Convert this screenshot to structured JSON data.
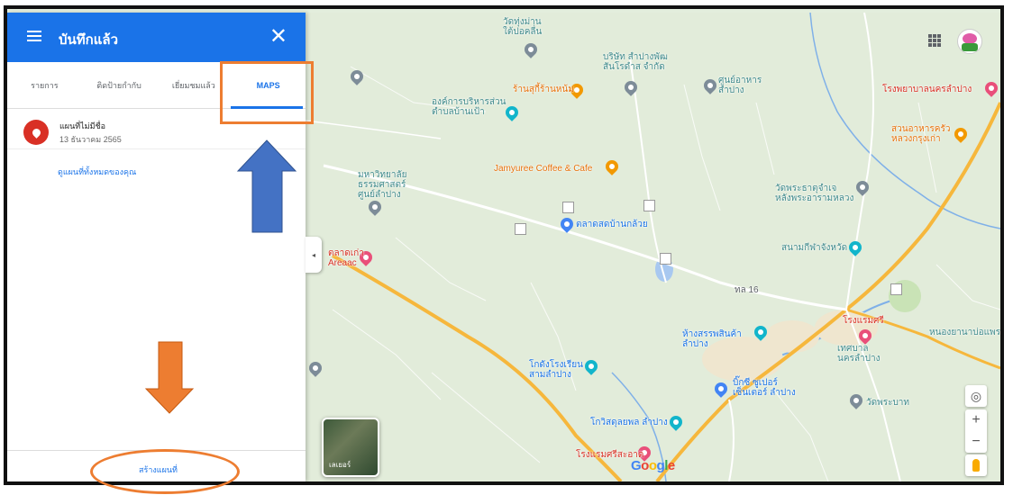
{
  "panel": {
    "title": "บันทึกแล้ว",
    "tabs": [
      "รายการ",
      "ติดป้ายกำกับ",
      "เยี่ยมชมแล้ว",
      "MAPS"
    ],
    "active_tab": "MAPS",
    "map_item": {
      "title": "แผนที่ไม่มีชื่อ",
      "date": "13 ธันวาคม 2565"
    },
    "all_maps_link": "ดูแผนที่ทั้งหมดของคุณ",
    "create_map": "สร้างแผนที่"
  },
  "map": {
    "layer_label": "เลเยอร์",
    "road_label": "ทล 16",
    "pois": [
      {
        "label": "วัดทุ่งม่าน\nใต้ปอคลื่น"
      },
      {
        "label": "บริษัท สำปางพัฒ\nสันโรดำส จำกัด"
      },
      {
        "label": "ศูนย์อาหาร\nสำปาง"
      },
      {
        "label": "ร้านสุกี้ร้านหน้ม"
      },
      {
        "label": "องค์การบริหารส่วน\nตำบลบ้านเป้า"
      },
      {
        "label": "Jamyuree Coffee & Cafe"
      },
      {
        "label": "มหาวิทยาลัย\nธรรมศาสตร์\nศูนย์ลำปาง"
      },
      {
        "label": "ตลาดสดบ้านกล้วย"
      },
      {
        "label": "วัดพระธาตุจำเจ\nหลังพระอารามหลวง"
      },
      {
        "label": "สนามกีฬาจังหวัด"
      },
      {
        "label": "โรงพยาบาลนครลำปาง"
      },
      {
        "label": "สวนอาหารครัว\nหลวงกรุงเก่า"
      },
      {
        "label": "ตลาดเก่า\nAreaac"
      },
      {
        "label": "ห้างสรรพสินค้า\nลำปาง"
      },
      {
        "label": "โรงแรมศรี"
      },
      {
        "label": "เทศบาล\nนครลำปาง"
      },
      {
        "label": "โกดังโรงเรียน\nสามลำปาง"
      },
      {
        "label": "บิ๊กซี ซูเปอร์\nเซ็นเตอร์ ลำปาง"
      },
      {
        "label": "วัดพระบาท"
      },
      {
        "label": "โกวิสดุลยพล ลำปาง"
      },
      {
        "label": "โรงแรมศรีสะอาด"
      },
      {
        "label": "หนองยานาบ่อแพร"
      }
    ]
  },
  "attribution": {
    "google": [
      "G",
      "o",
      "o",
      "g",
      "l",
      "e"
    ]
  },
  "colors": {
    "accent": "#1a73e8",
    "annotation": "#ed7d31",
    "arrow_blue": "#4472c4"
  }
}
